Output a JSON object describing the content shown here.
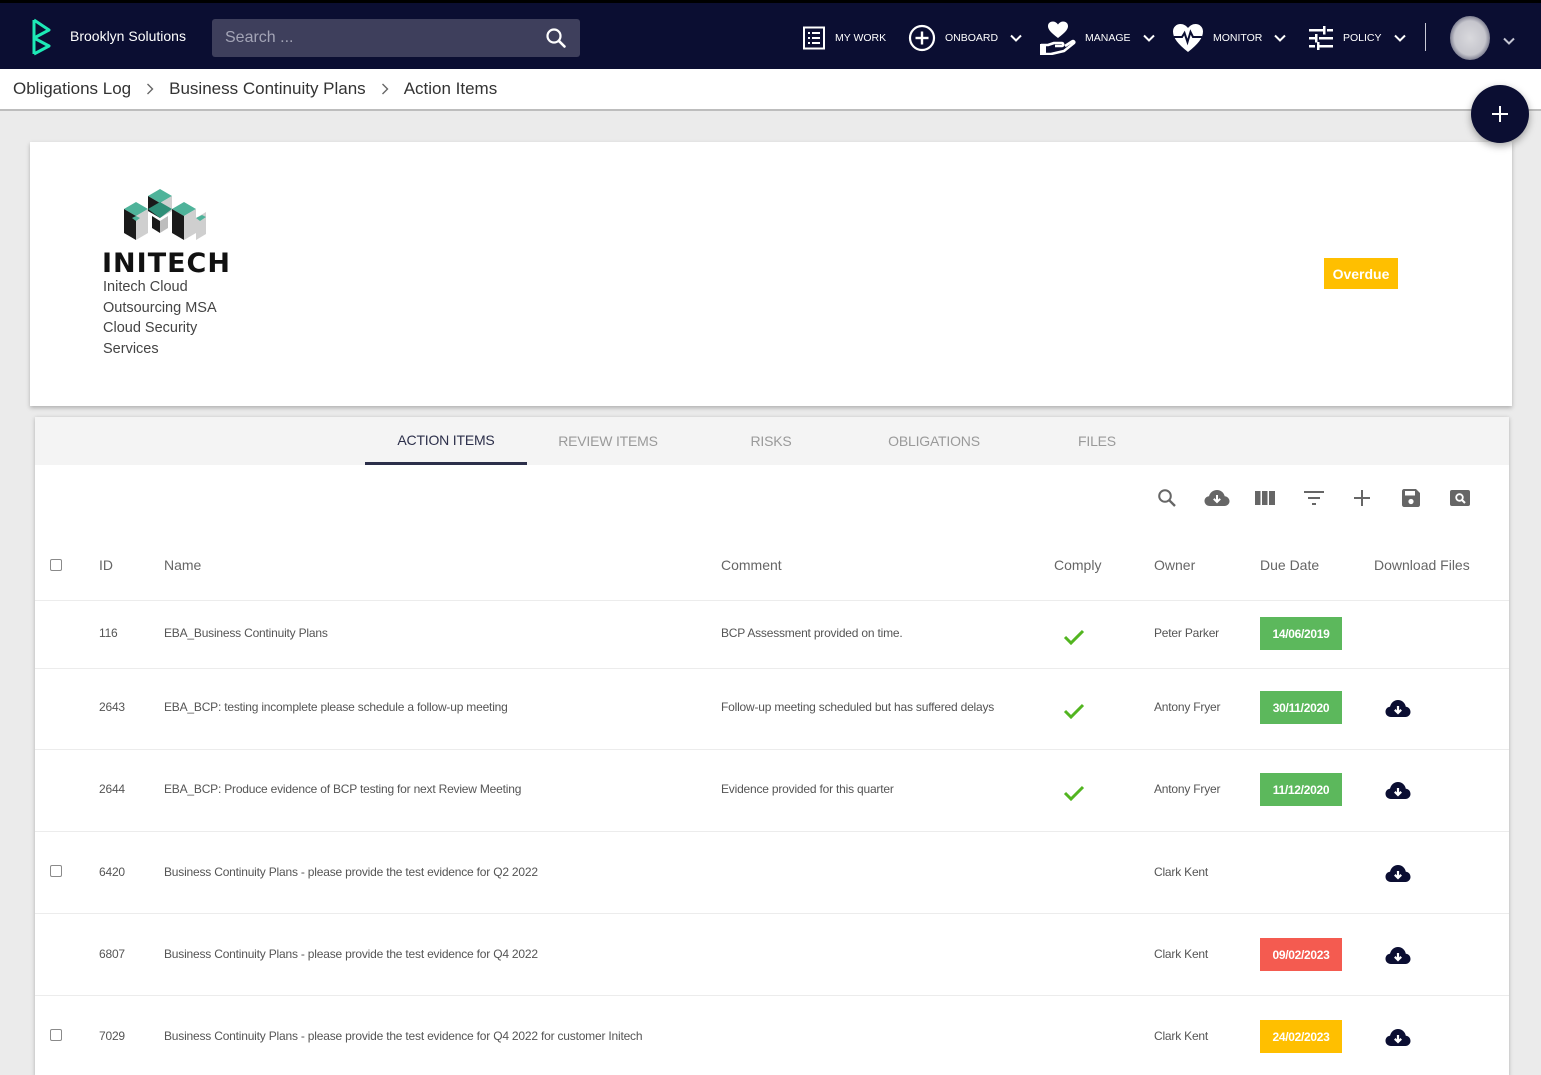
{
  "app": {
    "brand_name": "Brooklyn Solutions",
    "search_placeholder": "Search ...",
    "nav": [
      {
        "label": "MY WORK",
        "icon": "list-icon",
        "has_dropdown": false
      },
      {
        "label": "ONBOARD",
        "icon": "plus-circle-icon",
        "has_dropdown": true
      },
      {
        "label": "MANAGE",
        "icon": "hand-heart-icon",
        "has_dropdown": true
      },
      {
        "label": "MONITOR",
        "icon": "heart-pulse-icon",
        "has_dropdown": true
      },
      {
        "label": "POLICY",
        "icon": "sliders-icon",
        "has_dropdown": true
      }
    ]
  },
  "breadcrumb": [
    "Obligations Log",
    "Business Continuity Plans",
    "Action Items"
  ],
  "fab": {
    "icon": "plus-icon"
  },
  "header_card": {
    "company_logo_text": "INITECH",
    "description_lines": [
      "Initech Cloud",
      "Outsourcing MSA",
      "Cloud Security",
      "Services"
    ],
    "status": "Overdue",
    "status_color": "#ffbf00"
  },
  "tabs": [
    {
      "label": "ACTION ITEMS",
      "active": true
    },
    {
      "label": "REVIEW ITEMS",
      "active": false
    },
    {
      "label": "RISKS",
      "active": false
    },
    {
      "label": "OBLIGATIONS",
      "active": false
    },
    {
      "label": "FILES",
      "active": false
    }
  ],
  "toolbar": [
    "search-icon",
    "cloud-download-icon",
    "columns-icon",
    "filter-icon",
    "plus-icon",
    "save-icon",
    "preview-search-icon"
  ],
  "table": {
    "columns": [
      "ID",
      "Name",
      "Comment",
      "Comply",
      "Owner",
      "Due Date",
      "Download Files"
    ],
    "rows": [
      {
        "id": "116",
        "name": "EBA_Business Continuity Plans",
        "comment": "BCP Assessment provided on time.",
        "comply": true,
        "owner": "Peter Parker",
        "due_date": "14/06/2019",
        "due_status": "green",
        "has_files": false,
        "checkbox": false
      },
      {
        "id": "2643",
        "name": "EBA_BCP: testing incomplete please schedule a follow-up meeting",
        "comment": "Follow-up meeting scheduled but has suffered delays",
        "comply": true,
        "owner": "Antony Fryer",
        "due_date": "30/11/2020",
        "due_status": "green",
        "has_files": true,
        "checkbox": false
      },
      {
        "id": "2644",
        "name": "EBA_BCP: Produce evidence of BCP testing for next Review Meeting",
        "comment": "Evidence provided for this quarter",
        "comply": true,
        "owner": "Antony Fryer",
        "due_date": "11/12/2020",
        "due_status": "green",
        "has_files": true,
        "checkbox": false
      },
      {
        "id": "6420",
        "name": "Business Continuity Plans - please provide the test evidence for Q2 2022",
        "comment": "",
        "comply": false,
        "owner": "Clark Kent",
        "due_date": "",
        "due_status": "none",
        "has_files": true,
        "checkbox": true
      },
      {
        "id": "6807",
        "name": "Business Continuity Plans - please provide the test evidence for Q4 2022",
        "comment": "",
        "comply": false,
        "owner": "Clark Kent",
        "due_date": "09/02/2023",
        "due_status": "red",
        "has_files": true,
        "checkbox": false
      },
      {
        "id": "7029",
        "name": "Business Continuity Plans - please provide the test evidence for Q4 2022 for customer Initech",
        "comment": "",
        "comply": false,
        "owner": "Clark Kent",
        "due_date": "24/02/2023",
        "due_status": "amber",
        "has_files": true,
        "checkbox": true
      }
    ]
  },
  "colors": {
    "navbar": "#0b0e32",
    "accent_teal": "#1de9b6",
    "green": "#5cb85c",
    "red": "#f45b50",
    "amber": "#ffbf00",
    "check_green": "#52b520"
  }
}
